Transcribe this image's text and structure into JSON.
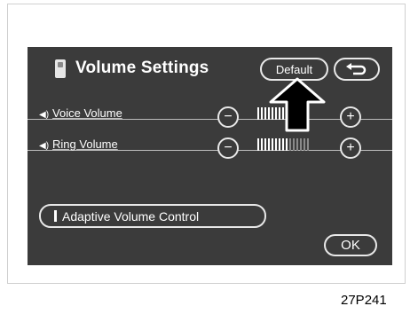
{
  "header": {
    "title": "Volume Settings",
    "default_label": "Default",
    "back_icon": "return-arrow-icon"
  },
  "rows": [
    {
      "label": "Voice Volume",
      "level": 0.55,
      "segments": 15
    },
    {
      "label": "Ring Volume",
      "level": 0.6,
      "segments": 15
    }
  ],
  "buttons": {
    "minus": "−",
    "plus": "+",
    "adaptive_label": "Adaptive Volume Control",
    "ok_label": "OK"
  },
  "figure_code": "27P241",
  "colors": {
    "screen_bg": "#3b3b3b",
    "bar_on": "#ffffff",
    "bar_off": "#8a8a8a"
  }
}
